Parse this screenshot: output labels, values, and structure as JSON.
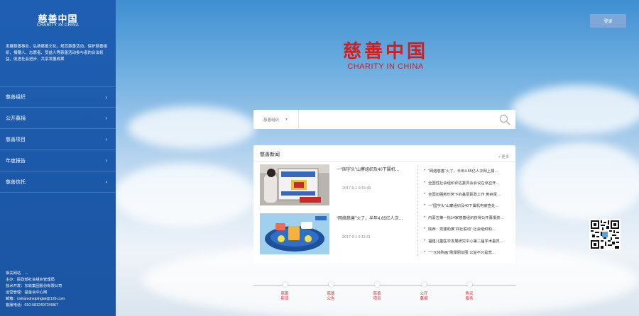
{
  "sidebar": {
    "title": "慈善中国",
    "subtitle": "CHARITY IN CHINA",
    "description": "发展慈善事业，弘扬慈善文化，规范慈善活动，保护慈善组织、捐赠人、志愿者、受益人等慈善活动参与者的合法权益，促进社会进步、共享发展成果",
    "nav": [
      {
        "label": "慈善组织"
      },
      {
        "label": "公开募捐"
      },
      {
        "label": "慈善项目"
      },
      {
        "label": "年度报告"
      },
      {
        "label": "慈善信托"
      }
    ],
    "footer": [
      "相关网站　→",
      "主办：民政部社会组织管理局",
      "技术开发：东软集团股份有限公司",
      "运营管理：基金会中心网",
      "邮箱：cishanxinxipingtai@126.com",
      "客服电话：010-58124072/4067"
    ]
  },
  "header": {
    "login_label": "登录"
  },
  "logo": {
    "cn": "慈善中国",
    "en": "CHARITY IN CHINA"
  },
  "search": {
    "category": "慈善组织",
    "value": ""
  },
  "news": {
    "title": "慈善新闻",
    "more": "+ 更多",
    "featured": [
      {
        "title": "一“国字头”山寨组织及40下属机…",
        "time": "2017-9-1 9:15:49"
      },
      {
        "title": "“网络慈善”火了，半年4.65亿人次…",
        "time": "2017-9-1 9:11:31"
      }
    ],
    "list": [
      "“网络慈善”火了，半年4.65亿人次网上捐…",
      "全国性社会组织评估委员会会议在京召开…",
      "全国加强新形势下的基层民政工作 黄树贤…",
      "一“国字头”山寨组织及40下属机构被查处…",
      "内蒙古第一批14家慈善组织获得公开募捐资…",
      "陕西：党建助推“四社联动” 社会组织助…",
      "福建儿童医学发展研究中心第二届学术委员…",
      "“一元钱购画”刷爆朋友圈 公益不只是悲…"
    ]
  },
  "bottom_nav": [
    {
      "l1": "慈善",
      "l2": "新闻"
    },
    {
      "l1": "慈善",
      "l2": "公告"
    },
    {
      "l1": "慈善",
      "l2": "项目"
    },
    {
      "l1": "公开",
      "l2": "募捐"
    },
    {
      "l1": "购买",
      "l2": "服务"
    }
  ],
  "colors": {
    "sidebar": "#1f5fb3",
    "accent_red": "#d01f1f",
    "login": "#7ea7d8"
  }
}
